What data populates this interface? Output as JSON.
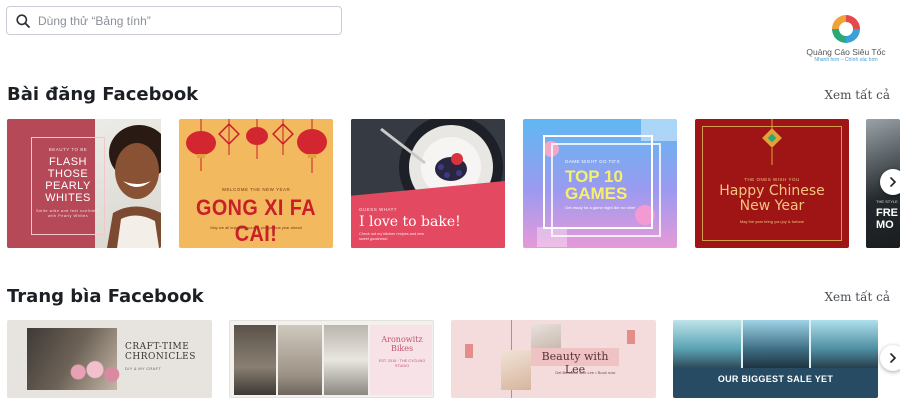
{
  "search": {
    "placeholder": "Dùng thử “Bảng tính”",
    "value": ""
  },
  "logo": {
    "name": "Quảng Cáo Siêu Tốc",
    "tagline": "Nhanh hơn – Chính xác hơn",
    "colors": [
      "#e5484d",
      "#2aa876",
      "#3aa0d8"
    ]
  },
  "sections": [
    {
      "title": "Bài đăng Facebook",
      "see_all": "Xem tất cả",
      "cards": [
        {
          "small_top": "BEAUTY TO BE",
          "title_lines": [
            "FLASH",
            "THOSE",
            "PEARLY",
            "WHITES"
          ],
          "footer": "Smile wide and feel confident with Pearly Whites",
          "background": "#b64957"
        },
        {
          "small_top": "WELCOME THE NEW YEAR",
          "title": "GONG XI FA CAI!",
          "footer": "May we all enjoy a joyous & prosperous year ahead",
          "background": "#f3b95f"
        },
        {
          "small_top": "GUESS WHAT?",
          "title": "I love to bake!",
          "footer": "Check out my kitchen recipes and new sweet goodness!",
          "background": "#e34a61"
        },
        {
          "small_top": "GAME NIGHT GO TO'S",
          "title_lines": [
            "TOP 10",
            "GAMES"
          ],
          "footer": "Get ready for a game night like no other",
          "background": "#8fa6f2"
        },
        {
          "small_top": "THE ONES WISH YOU",
          "title_lines": [
            "Happy Chinese",
            "New Year"
          ],
          "footer": "May the year bring you joy & fortune",
          "background": "#9f1516"
        },
        {
          "small_top": "THE STYLE",
          "title_lines": [
            "FRE",
            "MO"
          ],
          "background": "#23282c"
        }
      ]
    },
    {
      "title": "Trang bìa Facebook",
      "see_all": "Xem tất cả",
      "cards": [
        {
          "title_lines": [
            "CRAFT-TIME",
            "CHRONICLES"
          ],
          "footer": "DIY & MY CRAFT",
          "background": "#e7e4df"
        },
        {
          "title_lines": [
            "Aronowitz",
            "Bikes"
          ],
          "footer": "EST. 2016 · THE CYCLING STUDIO",
          "background": "#f3f1ee"
        },
        {
          "title": "Beauty with Lee",
          "footer": "Get Beautiful with Lee • Book now",
          "background": "#f4dcdc"
        },
        {
          "title": "OUR BIGGEST SALE YET",
          "background": "#264b63"
        }
      ]
    }
  ],
  "icons": {
    "search": "search-icon",
    "next": "chevron-right-icon"
  }
}
